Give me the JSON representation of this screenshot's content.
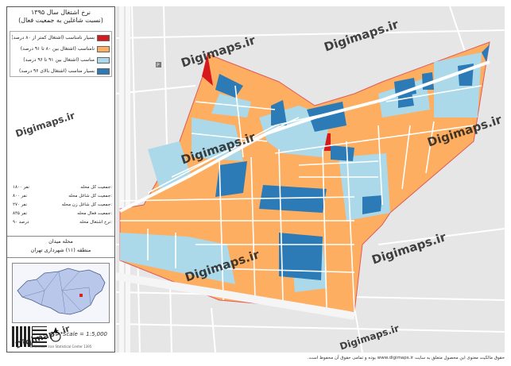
{
  "sidebar": {
    "title": "نرخ اشتغال سال ۱۳۹۵",
    "subtitle": "(نسبت شاغلین به جمعیت فعال)",
    "legend": [
      {
        "label": "بسیار نامناسب (اشتغال کمتر از ۸۰ درصد)",
        "color": "#d7191c"
      },
      {
        "label": "نامناسب (اشتغال بین ۸۰ تا ۹۱ درصد)",
        "color": "#fdae61"
      },
      {
        "label": "مناسب (اشتغال بین ۹۱ تا ۹۶ درصد)",
        "color": "#abd9e9"
      },
      {
        "label": "بسیار مناسب (اشتغال بالای ۹۶ درصد)",
        "color": "#2c7bb6"
      }
    ],
    "stats": [
      {
        "label": "جمعیت کل محله:",
        "value": "۱۸۰۰ نفر"
      },
      {
        "label": "جمعیت کل شاغل محله:",
        "value": "۸۰۰ نفر"
      },
      {
        "label": "جمعیت کل شاغل زن محله:",
        "value": "۲۷۰ نفر"
      },
      {
        "label": "جمعیت فعال محله:",
        "value": "۸۴۵ نفر"
      },
      {
        "label": "نرخ اشتغال محله:",
        "value": "۹۰ درصد"
      }
    ],
    "place_name": "محله میدان",
    "region": "منطقه (۱۱) شهرداری تهران",
    "north_label": "N",
    "scale": "Scale = 1:5,000",
    "credit": "Reference: Iran Statistical Center 1395"
  },
  "map": {
    "watermark": "Digimaps.ir",
    "colors": {
      "very_poor": "#d7191c",
      "poor": "#fdae61",
      "good": "#abd9e9",
      "very_good": "#2c7bb6",
      "street": "#ffffff",
      "background": "#e6e6e6",
      "boundary": "#e05a5a"
    }
  },
  "footer": {
    "note": "حقوق مالکیت معنوی این محصول متعلق به سایت www.digimaps.ir بوده و تمامی حقوق آن محفوظ است."
  }
}
